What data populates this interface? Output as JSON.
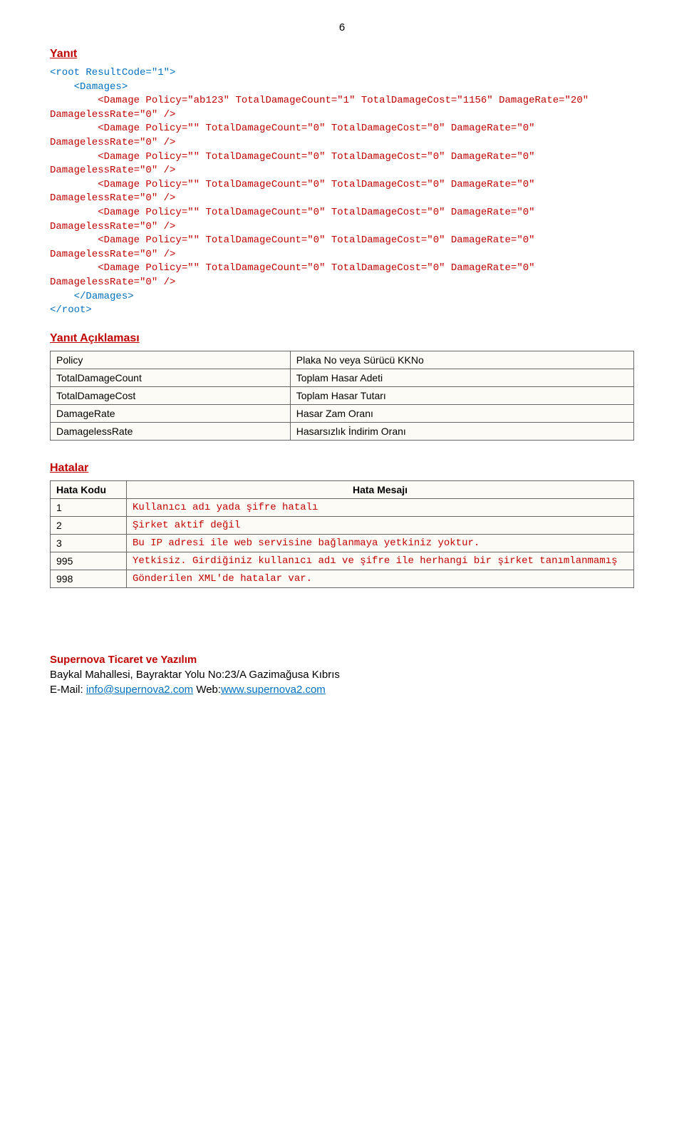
{
  "pageNumber": "6",
  "sections": {
    "yanit": "Yanıt",
    "yanitAciklamasi": "Yanıt Açıklaması",
    "hatalar": "Hatalar"
  },
  "xml": {
    "rootOpen": "<root ResultCode=\"1\">",
    "damagesOpen": "<Damages>",
    "damageFirst": "<Damage Policy=\"ab123\" TotalDamageCount=\"1\" TotalDamageCost=\"1156\" DamageRate=\"20\" DamagelessRate=\"0\" />",
    "damageEmpty": "<Damage Policy=\"\" TotalDamageCount=\"0\" TotalDamageCost=\"0\" DamageRate=\"0\" DamagelessRate=\"0\" />",
    "damagesClose": "</Damages>",
    "rootClose": "</root>"
  },
  "descTable": {
    "rows": [
      {
        "key": "Policy",
        "val": "Plaka No veya Sürücü KKNo"
      },
      {
        "key": "TotalDamageCount",
        "val": "Toplam Hasar Adeti"
      },
      {
        "key": "TotalDamageCost",
        "val": "Toplam Hasar Tutarı"
      },
      {
        "key": "DamageRate",
        "val": "Hasar Zam Oranı"
      },
      {
        "key": "DamagelessRate",
        "val": "Hasarsızlık İndirim Oranı"
      }
    ]
  },
  "errorTable": {
    "headers": {
      "code": "Hata Kodu",
      "msg": "Hata Mesajı"
    },
    "rows": [
      {
        "code": "1",
        "msg": "Kullanıcı adı yada şifre hatalı"
      },
      {
        "code": "2",
        "msg": "Şirket aktif değil"
      },
      {
        "code": "3",
        "msg": "Bu IP adresi ile web servisine bağlanmaya yetkiniz yoktur."
      },
      {
        "code": "995",
        "msg": "Yetkisiz. Girdiğiniz kullanıcı adı ve şifre ile herhangi bir şirket tanımlanmamış"
      },
      {
        "code": "998",
        "msg": "Gönderilen XML'de hatalar var."
      }
    ]
  },
  "footer": {
    "company": "Supernova Ticaret ve Yazılım",
    "address": "Baykal Mahallesi, Bayraktar Yolu No:23/A Gazimağusa Kıbrıs",
    "emailLabel": "E-Mail: ",
    "email": "info@supernova2.com",
    "webLabel": " Web:",
    "web": "www.supernova2.com"
  }
}
